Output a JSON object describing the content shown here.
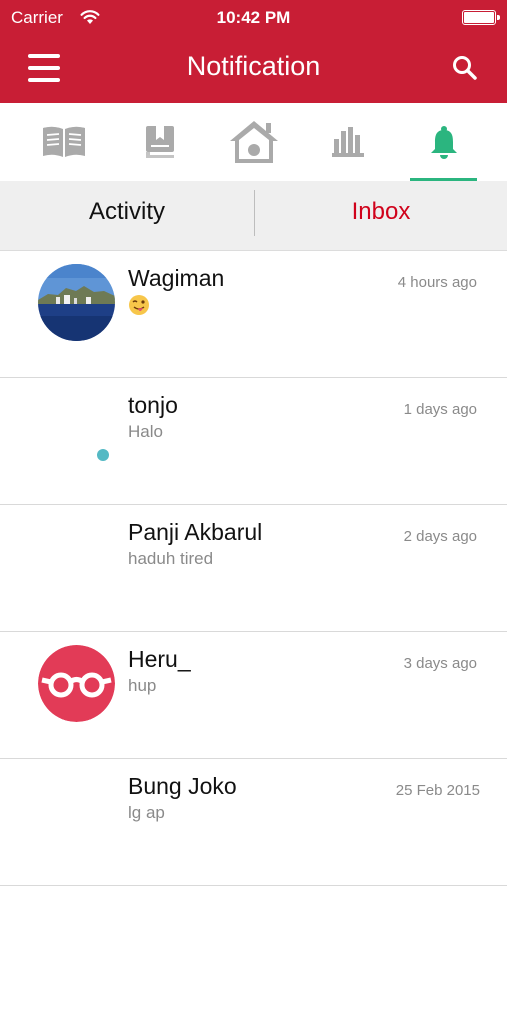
{
  "status_bar": {
    "carrier": "Carrier",
    "time": "10:42 PM"
  },
  "nav": {
    "title": "Notification",
    "left_icon": "hamburger-menu-icon",
    "right_icon": "search-icon"
  },
  "tabs": [
    {
      "icon": "open-book-icon",
      "selected": false
    },
    {
      "icon": "bookmark-book-icon",
      "selected": false
    },
    {
      "icon": "home-icon",
      "selected": false
    },
    {
      "icon": "bookshelf-icon",
      "selected": false
    },
    {
      "icon": "bell-icon",
      "selected": true
    }
  ],
  "segments": {
    "activity": "Activity",
    "inbox": "Inbox",
    "selected": "inbox"
  },
  "messages": [
    {
      "name": "Wagiman",
      "message": "",
      "message_icon": "winking-tongue-emoji-icon",
      "time": "4 hours ago",
      "avatar": "landscape-photo-avatar",
      "unread": false
    },
    {
      "name": "tonjo",
      "message": "Halo",
      "time": "1 days ago",
      "avatar": "",
      "unread": true
    },
    {
      "name": "Panji Akbarul",
      "message": "haduh tired",
      "time": "2 days ago",
      "avatar": "",
      "unread": false
    },
    {
      "name": "Heru_",
      "message": "hup",
      "time": "3 days ago",
      "avatar": "glasses-avatar",
      "unread": false
    },
    {
      "name": "Bung Joko",
      "message": "lg ap",
      "time": "25 Feb 2015",
      "avatar": "",
      "unread": false
    }
  ],
  "colors": {
    "header": "#c81e35",
    "inbox_active": "#d0021b",
    "tab_active": "#2bb57f",
    "tab_inactive": "#a9a9a9",
    "unread_dot": "#54b9c4",
    "heru_avatar": "#e23b57"
  }
}
